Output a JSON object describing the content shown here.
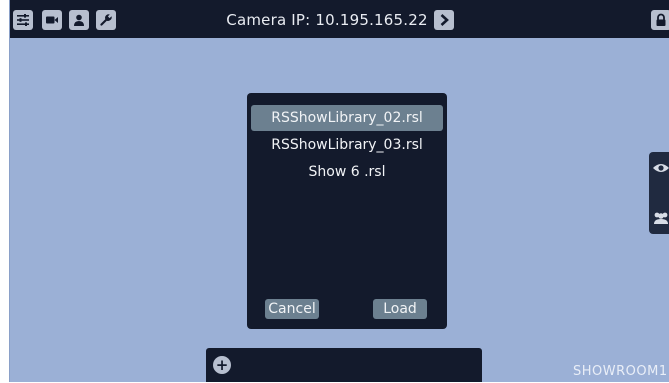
{
  "topbar": {
    "camera_ip_text": "Camera IP: 10.195.165.22",
    "icons": [
      "sliders-icon",
      "video-camera-icon",
      "user-icon",
      "wrench-icon",
      "chevron-right-icon",
      "lock-icon"
    ]
  },
  "dialog": {
    "files": [
      {
        "label": "RSShowLibrary_02.rsl",
        "selected": true
      },
      {
        "label": "RSShowLibrary_03.rsl",
        "selected": false
      },
      {
        "label": "Show 6 .rsl",
        "selected": false
      }
    ],
    "cancel_label": "Cancel",
    "load_label": "Load"
  },
  "bottom_bar": {
    "add_symbol": "+"
  },
  "watermark": "SHOWROOM1",
  "colors": {
    "background": "#9bb0d6",
    "bar": "#131a2c",
    "button": "#6c8090",
    "icon_bg": "#b7bfcf"
  }
}
